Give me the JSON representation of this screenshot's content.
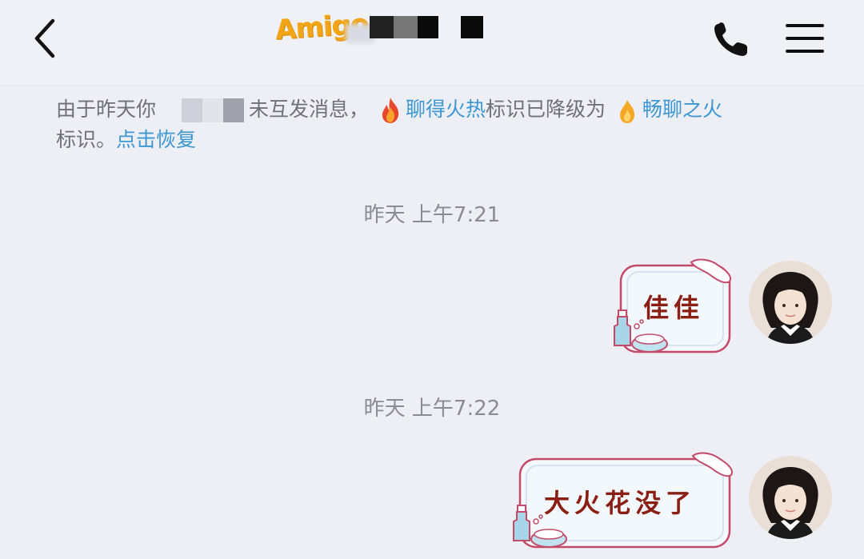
{
  "header": {
    "title_logo": "Amigo",
    "back_icon": "chevron-left-icon",
    "call_icon": "phone-icon",
    "menu_icon": "hamburger-menu-icon"
  },
  "notice": {
    "part1": "由于昨天你",
    "part2": "未互发消息，",
    "flame1_name": "聊得火热",
    "part3": "标识已降级为",
    "flame2_name": "畅聊之火",
    "part4": "标识。",
    "restore_link": "点击恢复"
  },
  "messages": [
    {
      "timestamp": "昨天 上午7:21",
      "text": "佳佳",
      "sender": "self"
    },
    {
      "timestamp": "昨天 上午7:22",
      "text": "大火花没了",
      "sender": "self"
    }
  ],
  "colors": {
    "link": "#3d97d4",
    "bubble_text": "#8a1e12",
    "bubble_border": "#c44a6a",
    "bubble_fill": "#f3f8fc"
  }
}
